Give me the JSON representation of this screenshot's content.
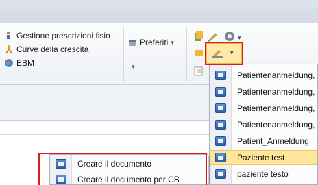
{
  "ribbon": {
    "gestione_label": "Gestione prescrizioni fisio",
    "curve_label": "Curve della crescita",
    "ebm_label": "EBM",
    "preferiti_label": "Preferiti",
    "dropdown_arrow": "▾"
  },
  "template_menu": {
    "items": [
      {
        "label": "Patientenanmeldung,"
      },
      {
        "label": "Patientenanmeldung,"
      },
      {
        "label": "Patientenanmeldung,"
      },
      {
        "label": "Patientenanmeldung,"
      },
      {
        "label": "Patient_Anmeldung"
      },
      {
        "label": "Paziente test"
      },
      {
        "label": "paziente testo"
      }
    ],
    "highlighted_index": 5
  },
  "create_menu": {
    "items": [
      {
        "label": "Creare il documento"
      },
      {
        "label": "Creare il documento per CB"
      }
    ]
  },
  "colors": {
    "highlight": "#ffe69a",
    "annotation": "#e01a1a"
  }
}
